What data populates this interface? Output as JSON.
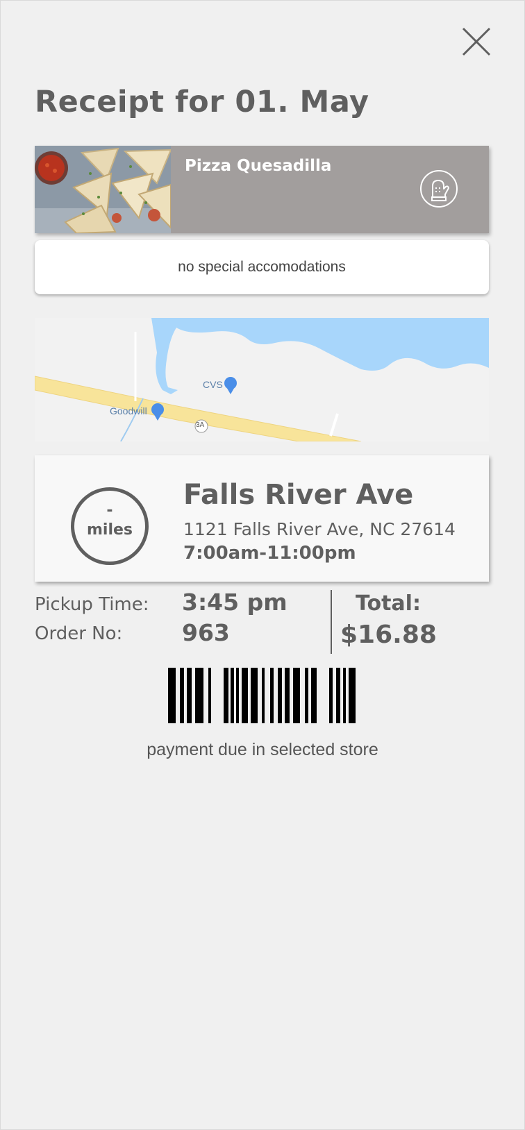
{
  "page": {
    "title": "Receipt for 01. May"
  },
  "icons": {
    "close": "close-icon",
    "oven_mitt": "oven-mitt-icon",
    "map_pin": "map-pin-icon"
  },
  "colors": {
    "text": "#5f5f5f",
    "item_card_bg": "#a29e9d",
    "background": "#f0f0f0"
  },
  "item": {
    "name": "Pizza Quesadilla",
    "accommodations": "no special accomodations"
  },
  "map": {
    "labels": {
      "cvs": "CVS",
      "goodwill": "Goodwill",
      "route": "3A"
    }
  },
  "store": {
    "distance_value": "-",
    "distance_unit": "miles",
    "name": "Falls River Ave",
    "address": "1121 Falls River Ave, NC 27614",
    "hours": "7:00am-11:00pm"
  },
  "order": {
    "pickup_label": "Pickup Time:",
    "pickup_time": "3:45 pm",
    "order_label": "Order No:",
    "order_number": "963",
    "total_label": "Total:",
    "total_value": "$16.88"
  },
  "payment_note": "payment due in selected store"
}
